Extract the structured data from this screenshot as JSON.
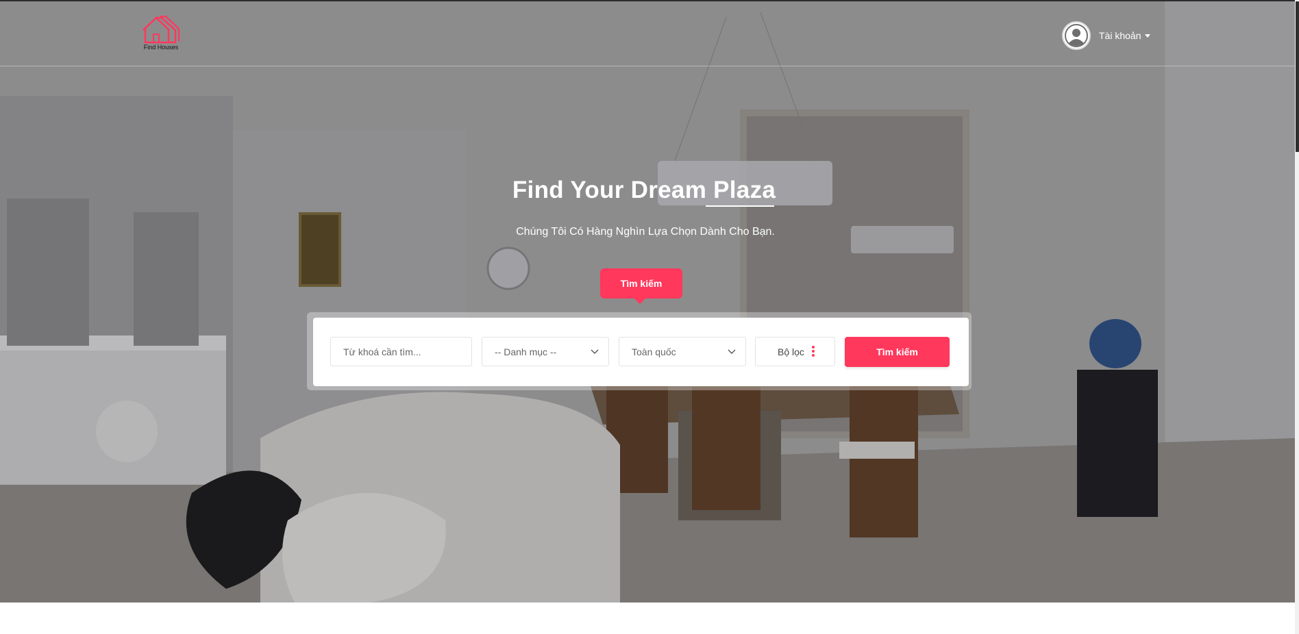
{
  "header": {
    "logo_text": "Find Houses",
    "account_label": "Tài khoản"
  },
  "hero": {
    "title": "Find Your Dream Plaza",
    "subtitle": "Chúng Tôi Có Hàng Nghìn Lựa Chọn Dành Cho Bạn.",
    "tab_label": "Tìm kiếm"
  },
  "search": {
    "keyword_placeholder": "Từ khoá cần tìm...",
    "category_selected": "-- Danh mục --",
    "location_selected": "Toàn quốc",
    "filter_label": "Bộ lọc",
    "submit_label": "Tìm kiếm"
  },
  "colors": {
    "accent": "#ff385c",
    "header_text": "#ffffff"
  }
}
